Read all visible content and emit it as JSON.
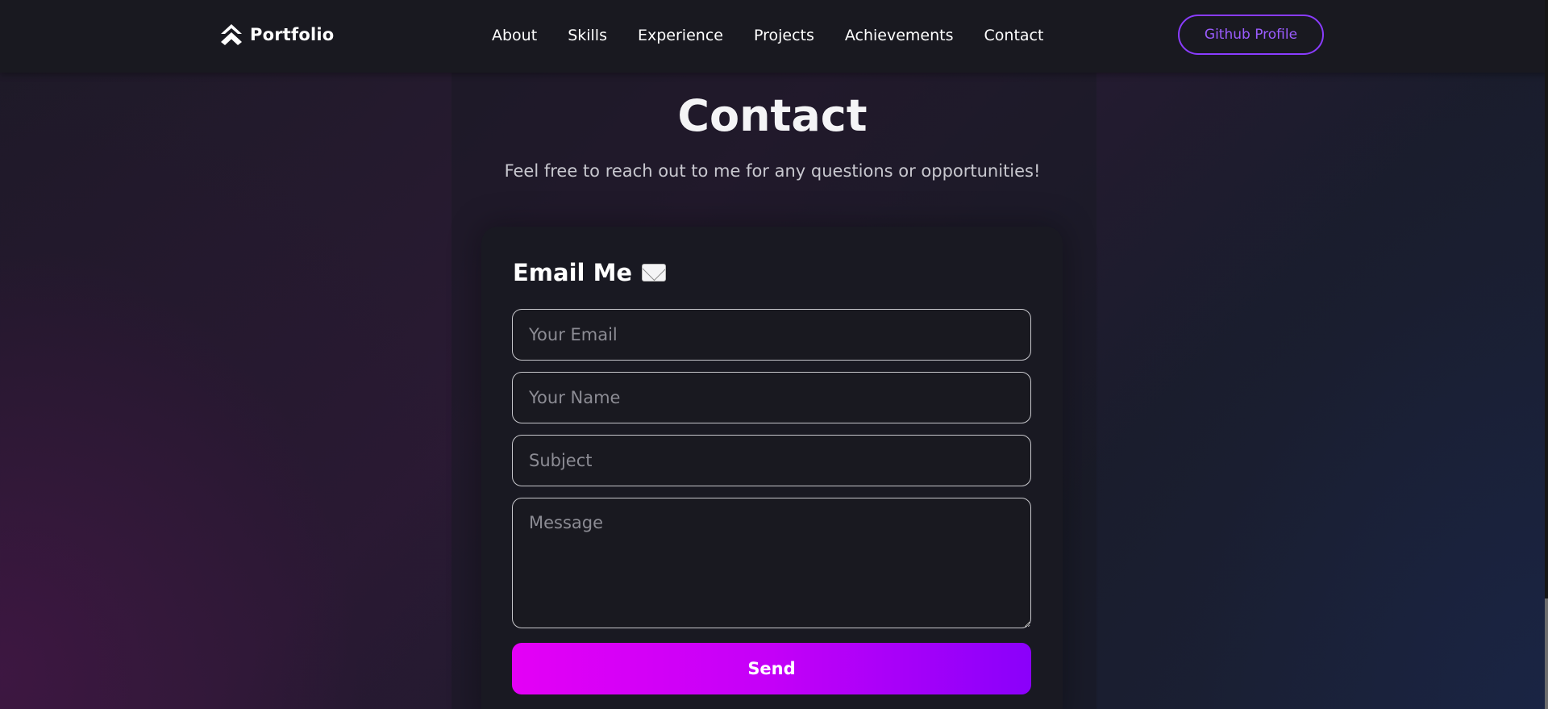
{
  "brand": {
    "name": "Portfolio",
    "icon": "double-chevron-up-icon"
  },
  "nav": {
    "links": [
      {
        "label": "About"
      },
      {
        "label": "Skills"
      },
      {
        "label": "Experience"
      },
      {
        "label": "Projects"
      },
      {
        "label": "Achievements"
      },
      {
        "label": "Contact"
      }
    ],
    "github_button": "Github Profile"
  },
  "contact": {
    "title": "Contact",
    "subtitle": "Feel free to reach out to me for any questions or opportunities!"
  },
  "form": {
    "title": "Email Me",
    "title_icon": "envelope-icon",
    "email_placeholder": "Your Email",
    "name_placeholder": "Your Name",
    "subject_placeholder": "Subject",
    "message_placeholder": "Message",
    "send_label": "Send"
  },
  "colors": {
    "accent": "#8a3cff",
    "send_gradient_start": "#e400f6",
    "send_gradient_end": "#8a00fa",
    "background": "#1c1a26"
  }
}
